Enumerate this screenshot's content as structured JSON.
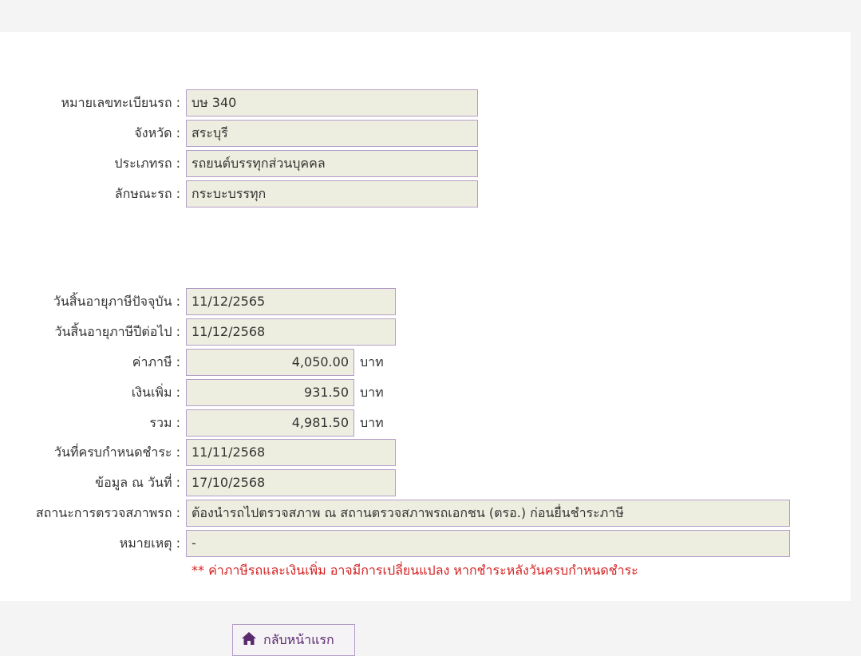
{
  "vehicle": {
    "plate_label": "หมายเลขทะเบียนรถ :",
    "plate_value": "บษ 340",
    "province_label": "จังหวัด :",
    "province_value": "สระบุรี",
    "type_label": "ประเภทรถ :",
    "type_value": "รถยนต์บรรทุกส่วนบุคคล",
    "style_label": "ลักษณะรถ :",
    "style_value": "กระบะบรรทุก"
  },
  "tax": {
    "current_expiry_label": "วันสิ้นอายุภาษีปัจจุบัน :",
    "current_expiry_value": "11/12/2565",
    "next_expiry_label": "วันสิ้นอายุภาษีปีต่อไป :",
    "next_expiry_value": "11/12/2568",
    "tax_label": "ค่าภาษี :",
    "tax_value": "4,050.00",
    "surcharge_label": "เงินเพิ่ม :",
    "surcharge_value": "931.50",
    "total_label": "รวม :",
    "total_value": "4,981.50",
    "currency_unit": "บาท",
    "due_date_label": "วันที่ครบกำหนดชำระ :",
    "due_date_value": "11/11/2568",
    "data_as_of_label": "ข้อมูล ณ วันที่ :",
    "data_as_of_value": "17/10/2568",
    "inspection_label": "สถานะการตรวจสภาพรถ :",
    "inspection_value": "ต้องนำรถไปตรวจสภาพ ณ สถานตรวจสภาพรถเอกชน (ตรอ.) ก่อนยื่นชำระภาษี",
    "remark_label": "หมายเหตุ :",
    "remark_value": "-",
    "warning_note": "** ค่าภาษีรถและเงินเพิ่ม อาจมีการเปลี่ยนแปลง หากชำระหลังวันครบกำหนดชำระ"
  },
  "actions": {
    "home_button_label": "กลับหน้าแรก",
    "home_icon": "house-icon"
  },
  "colors": {
    "field_bg": "#eeeee0",
    "field_border": "#b39dc8",
    "warning_text": "#d42020",
    "button_text": "#5a2a6e"
  }
}
